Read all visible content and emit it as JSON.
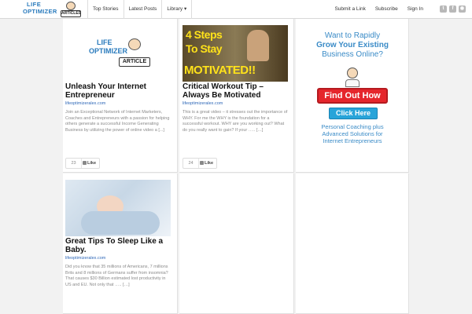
{
  "header": {
    "logo": {
      "line1": "LIFE",
      "line2": "OPTIMIZER",
      "badge": "ARTICLES"
    },
    "nav": [
      "Top Stories",
      "Latest Posts",
      "Library ▾"
    ],
    "right_links": [
      "Submit a Link",
      "Subscribe",
      "Sign In"
    ],
    "social_icons": [
      "twitter-icon",
      "facebook-icon",
      "rss-icon"
    ]
  },
  "cards": [
    {
      "thumb_logo": {
        "line1": "LIFE",
        "line2": "OPTIMIZER",
        "badge": "ARTICLE"
      },
      "title": "Unleash Your Internet Entrepreneur",
      "source": "lifeoptimizeralex.com",
      "description": "Join an Exceptional Network of Internet Marketers, Coaches and Entrepreneurs with a passion for helping others generate a successful Income Generating Business by utilizing the power of online video a [...]",
      "likes": "23",
      "like_label": "Like"
    },
    {
      "thumb_text": [
        "4 Steps",
        "To Stay",
        "MOTIVATED!!"
      ],
      "title": "Critical Workout Tip – Always Be Motivated",
      "source": "lifeoptimizeralex.com",
      "description": "This is a great video – it stresses out the importance of WHY. For me the WHY is the foundation for a successful workout. WHY are you working out? What do you really want to gain? If your ….. […]",
      "likes": "24",
      "like_label": "Like"
    },
    {
      "title": "Great Tips To Sleep Like a Baby.",
      "source": "lifeoptimizeralex.com",
      "description": "Did you know that 35 millions of Americans, 7 millions Brits and 8 millions of Germans suffer from insomnia? That causes $30 Billion estimated lost productivity in US and EU. Not only that ….. […]"
    }
  ],
  "ad": {
    "line1": "Want to Rapidly",
    "line2": "Grow Your Existing",
    "line3": "Business Online?",
    "button_primary": "Find Out How",
    "button_secondary": "Click Here",
    "footer": [
      "Personal Coaching plus",
      "Advanced Solutions for",
      "Internet Entrepreneurs"
    ]
  },
  "colors": {
    "accent": "#2a7bbd",
    "link": "#2f68b8",
    "ad_red": "#e5262c",
    "ad_teal": "#28a4d9"
  }
}
